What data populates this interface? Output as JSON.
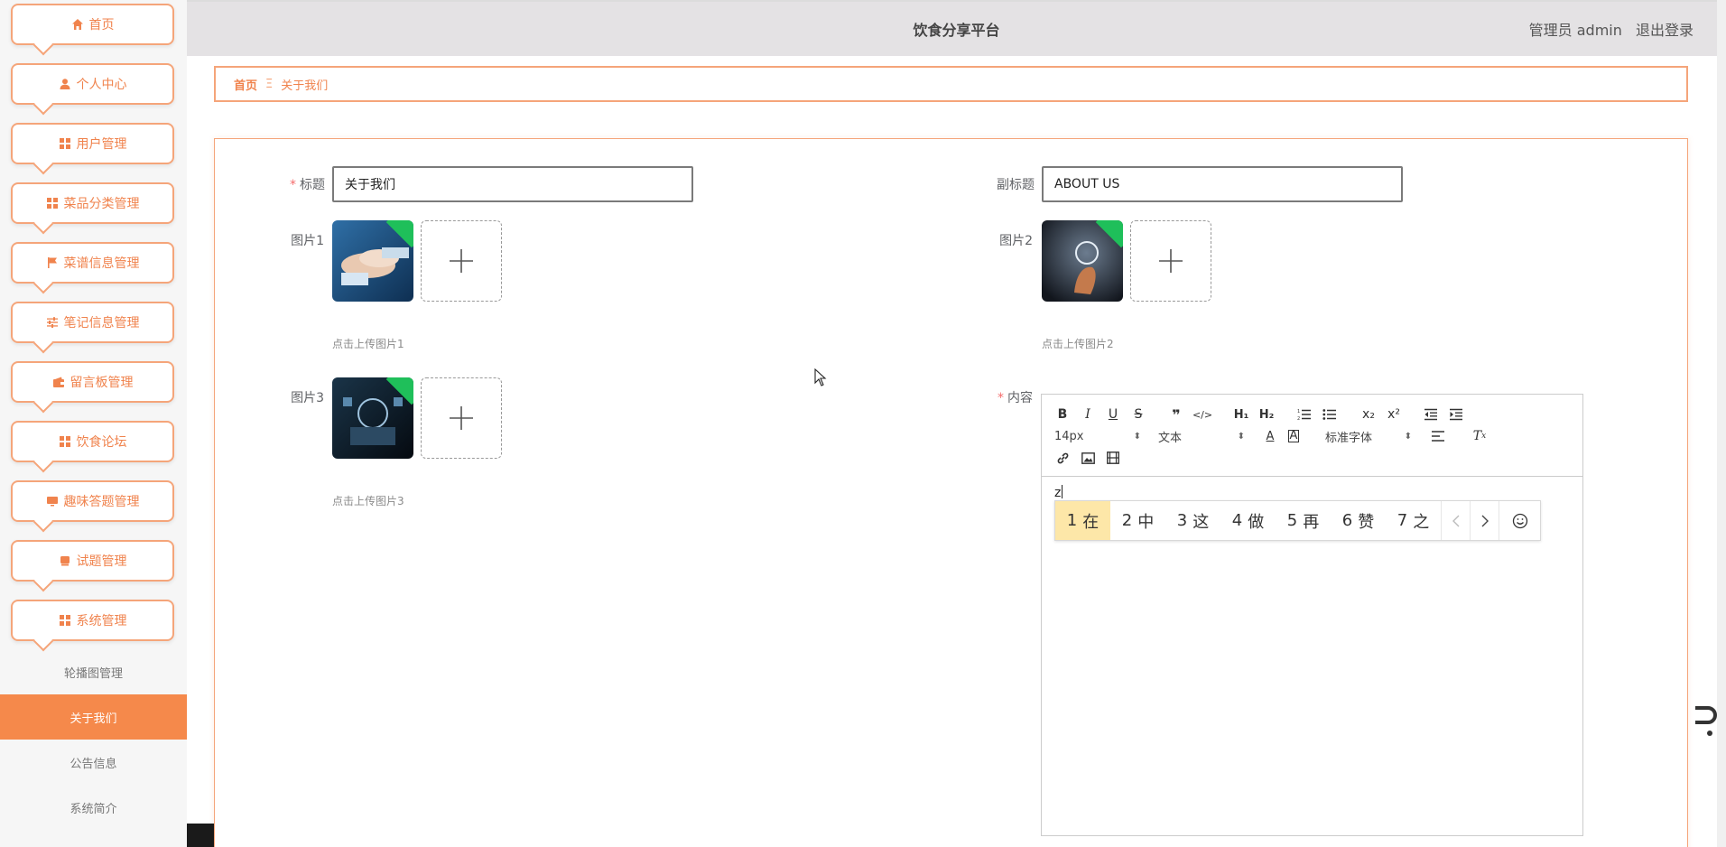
{
  "header": {
    "title": "饮食分享平台",
    "user_role": "管理员 admin",
    "logout": "退出登录"
  },
  "sidebar": {
    "items": [
      {
        "label": "首页",
        "icon": "home-icon"
      },
      {
        "label": "个人中心",
        "icon": "user-icon"
      },
      {
        "label": "用户管理",
        "icon": "grid-icon"
      },
      {
        "label": "菜品分类管理",
        "icon": "grid-icon"
      },
      {
        "label": "菜谱信息管理",
        "icon": "flag-icon"
      },
      {
        "label": "笔记信息管理",
        "icon": "sliders-icon"
      },
      {
        "label": "留言板管理",
        "icon": "wallet-icon"
      },
      {
        "label": "饮食论坛",
        "icon": "grid-icon"
      },
      {
        "label": "趣味答题管理",
        "icon": "monitor-icon"
      },
      {
        "label": "试题管理",
        "icon": "cup-icon"
      },
      {
        "label": "系统管理",
        "icon": "grid-icon"
      }
    ],
    "submenu": [
      {
        "label": "轮播图管理",
        "active": false
      },
      {
        "label": "关于我们",
        "active": true
      },
      {
        "label": "公告信息",
        "active": false
      },
      {
        "label": "系统简介",
        "active": false
      }
    ]
  },
  "breadcrumb": {
    "home": "首页",
    "separator": "Ξ",
    "current": "关于我们"
  },
  "form": {
    "title_label": "标题",
    "title_value": "关于我们",
    "subtitle_label": "副标题",
    "subtitle_value": "ABOUT US",
    "pic1_label": "图片1",
    "pic1_hint": "点击上传图片1",
    "pic2_label": "图片2",
    "pic2_hint": "点击上传图片2",
    "pic3_label": "图片3",
    "pic3_hint": "点击上传图片3",
    "content_label": "内容",
    "required_mark": "*"
  },
  "editor": {
    "font_size": "14px",
    "paragraph": "文本",
    "font_family": "标准字体",
    "typed_text": "z"
  },
  "ime": {
    "candidates": [
      {
        "n": "1",
        "c": "在"
      },
      {
        "n": "2",
        "c": "中"
      },
      {
        "n": "3",
        "c": "这"
      },
      {
        "n": "4",
        "c": "做"
      },
      {
        "n": "5",
        "c": "再"
      },
      {
        "n": "6",
        "c": "赞"
      },
      {
        "n": "7",
        "c": "之"
      }
    ]
  },
  "colors": {
    "accent": "#f0834d",
    "accent_border": "#f5a57a",
    "active_bg": "#f5894b",
    "header_bg": "#e4e2e4",
    "ime_highlight": "#fde7a8",
    "thumb_badge": "#1fbf5a"
  }
}
